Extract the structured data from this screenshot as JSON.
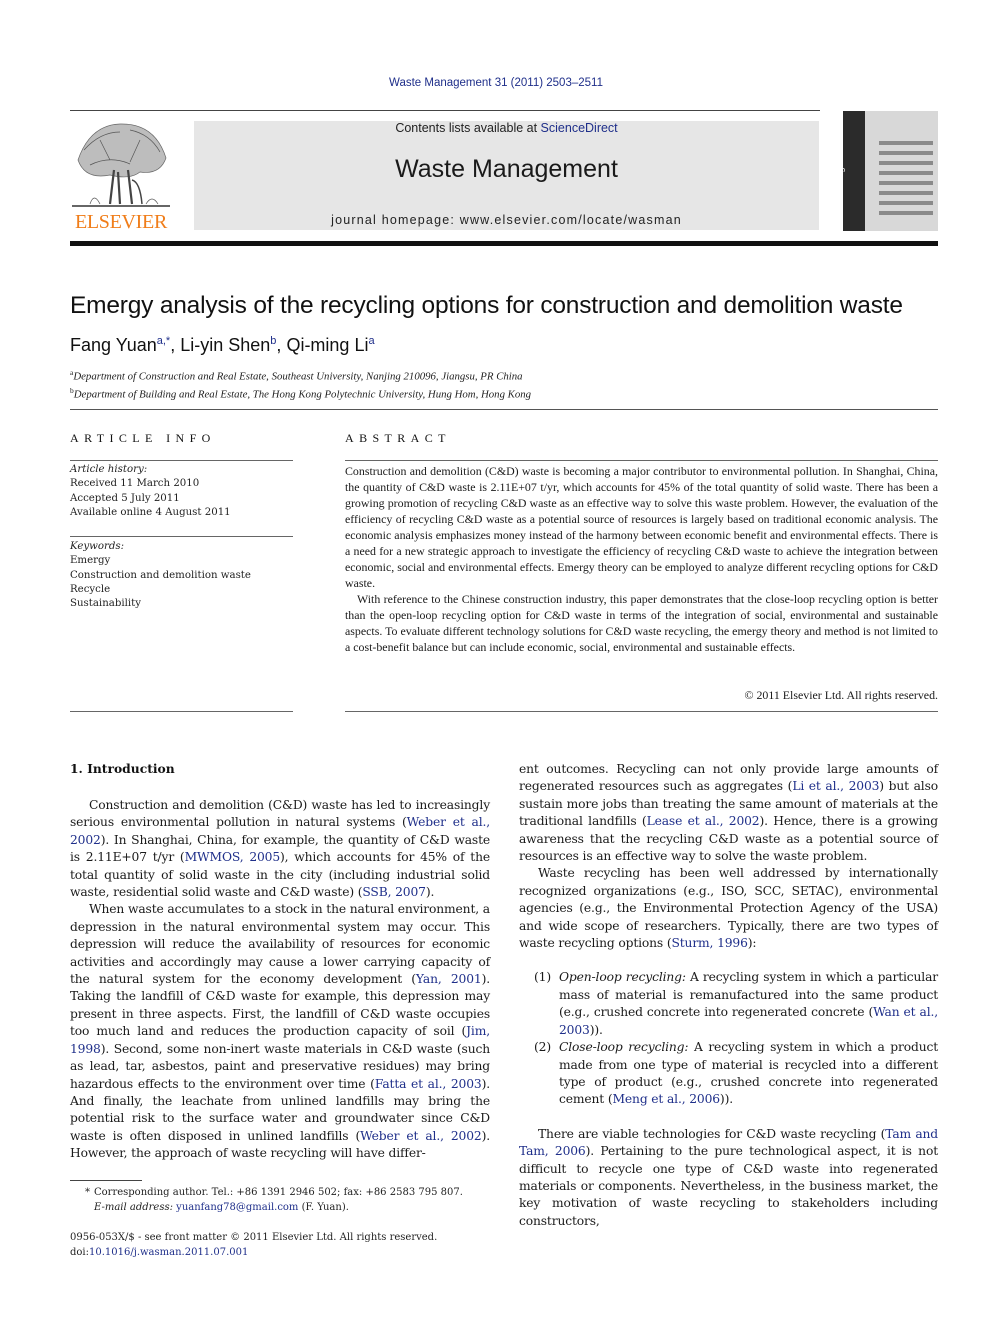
{
  "header": {
    "journal_reference": "Waste Management 31 (2011) 2503–2511",
    "contents_prefix": "Contents lists available at ",
    "contents_link": "ScienceDirect",
    "journal_title": "Waste Management",
    "homepage": "journal homepage: www.elsevier.com/locate/wasman",
    "publisher_logo_text": "ELSEVIER",
    "cover_spine_text": "waste management",
    "brand_color": "#f07d19",
    "link_color": "#1f2f8a"
  },
  "article": {
    "title": "Emergy analysis of the recycling options for construction and demolition waste",
    "authors": [
      {
        "name": "Fang Yuan",
        "sup": "a,*"
      },
      {
        "name": "Li-yin Shen",
        "sup": "b"
      },
      {
        "name": "Qi-ming Li",
        "sup": "a"
      }
    ],
    "affiliations": [
      {
        "mark": "a",
        "text": "Department of Construction and Real Estate, Southeast University, Nanjing 210096, Jiangsu, PR China"
      },
      {
        "mark": "b",
        "text": "Department of Building and Real Estate, The Hong Kong Polytechnic University, Hung Hom, Hong Kong"
      }
    ]
  },
  "article_info": {
    "heading": "ARTICLE INFO",
    "history_label": "Article history:",
    "history": [
      "Received 11 March 2010",
      "Accepted 5 July 2011",
      "Available online 4 August 2011"
    ],
    "keywords_label": "Keywords:",
    "keywords": [
      "Emergy",
      "Construction and demolition waste",
      "Recycle",
      "Sustainability"
    ]
  },
  "abstract": {
    "heading": "ABSTRACT",
    "paragraphs": [
      "Construction and demolition (C&D) waste is becoming a major contributor to environmental pollution. In Shanghai, China, the quantity of C&D waste is 2.11E+07 t/yr, which accounts for 45% of the total quantity of solid waste. There has been a growing promotion of recycling C&D waste as an effective way to solve this waste problem. However, the evaluation of the efficiency of recycling C&D waste as a potential source of resources is largely based on traditional economic analysis. The economic analysis emphasizes money instead of the harmony between economic benefit and environmental effects. There is a need for a new strategic approach to investigate the efficiency of recycling C&D waste to achieve the integration between economic, social and environmental effects. Emergy theory can be employed to analyze different recycling options for C&D waste.",
      "With reference to the Chinese construction industry, this paper demonstrates that the close-loop recycling option is better than the open-loop recycling option for C&D waste in terms of the integration of social, environmental and sustainable aspects. To evaluate different technology solutions for C&D waste recycling, the emergy theory and method is not limited to a cost-benefit balance but can include economic, social, environmental and sustainable effects."
    ],
    "copyright": "© 2011 Elsevier Ltd. All rights reserved."
  },
  "intro": {
    "heading": "1. Introduction",
    "p1": [
      {
        "t": "Construction and demolition (C&D) waste has led to increasingly serious environmental pollution in natural systems ("
      },
      {
        "link": "Weber et al., 2002"
      },
      {
        "t": "). In Shanghai, China, for example, the quantity of C&D waste is 2.11E+07 t/yr ("
      },
      {
        "link": "MWMOS, 2005"
      },
      {
        "t": "), which accounts for 45% of the total quantity of solid waste in the city (including industrial solid waste, residential solid waste and C&D waste) ("
      },
      {
        "link": "SSB, 2007"
      },
      {
        "t": ")."
      }
    ],
    "p2": [
      {
        "t": "When waste accumulates to a stock in the natural environment, a depression in the natural environmental system may occur. This depression will reduce the availability of resources for economic activities and accordingly may cause a lower carrying capacity of the natural system for the economy development ("
      },
      {
        "link": "Yan, 2001"
      },
      {
        "t": "). Taking the landfill of C&D waste for example, this depression may present in three aspects. First, the landfill of C&D waste occupies too much land and reduces the production capacity of soil ("
      },
      {
        "link": "Jim, 1998"
      },
      {
        "t": "). Second, some non-inert waste materials in C&D waste (such as lead, tar, asbestos, paint and preservative residues) may bring hazardous effects to the environment over time ("
      },
      {
        "link": "Fatta et al., 2003"
      },
      {
        "t": "). And finally, the leachate from unlined landfills may bring the potential risk to the surface water and groundwater since C&D waste is often disposed in unlined landfills ("
      },
      {
        "link": "Weber et al., 2002"
      },
      {
        "t": "). However, the approach of waste recycling will have different outcomes. Recycling can not only provide large amounts of regenerated resources such as aggregates ("
      },
      {
        "link": "Li et al., 2003"
      },
      {
        "t": ") but also sustain more jobs than treating the same amount of materials at the traditional landfills ("
      },
      {
        "link": "Lease et al., 2002"
      },
      {
        "t": "). Hence, there is a growing awareness that the recycling C&D waste as a potential source of resources is an effective way to solve the waste problem."
      }
    ],
    "p3": [
      {
        "t": "Waste recycling has been well addressed by internationally recognized organizations (e.g., ISO, SCC, SETAC), environmental agencies (e.g., the Environmental Protection Agency of the USA) and wide scope of researchers. Typically, there are two types of waste recycling options ("
      },
      {
        "link": "Sturm, 1996"
      },
      {
        "t": "):"
      }
    ],
    "list": [
      {
        "num": "(1)",
        "term": "Open-loop recycling:",
        "parts": [
          {
            "t": " A recycling system in which a particular mass of material is remanufactured into the same product (e.g., crushed concrete into regenerated concrete ("
          },
          {
            "link": "Wan et al., 2003"
          },
          {
            "t": "))."
          }
        ]
      },
      {
        "num": "(2)",
        "term": "Close-loop recycling:",
        "parts": [
          {
            "t": " A recycling system in which a product made from one type of material is recycled into a different type of product (e.g., crushed concrete into regenerated cement ("
          },
          {
            "link": "Meng et al., 2006"
          },
          {
            "t": "))."
          }
        ]
      }
    ],
    "p4": [
      {
        "t": "There are viable technologies for C&D waste recycling ("
      },
      {
        "link": "Tam and Tam, 2006"
      },
      {
        "t": "). Pertaining to the pure technological aspect, it is not difficult to recycle one type of C&D waste into regenerated materials or components. Nevertheless, in the business market, the key motivation of waste recycling to stakeholders including constructors,"
      }
    ]
  },
  "footnote": {
    "star": "*",
    "corresponding": "Corresponding author. Tel.: +86 1391 2946 502; fax: +86 2583 795 807.",
    "email_label": "E-mail address:",
    "email": "yuanfang78@gmail.com",
    "email_suffix": " (F. Yuan)."
  },
  "frontmatter": {
    "issn_line": "0956-053X/$ - see front matter © 2011 Elsevier Ltd. All rights reserved.",
    "doi_prefix": "doi:",
    "doi": "10.1016/j.wasman.2011.07.001"
  }
}
